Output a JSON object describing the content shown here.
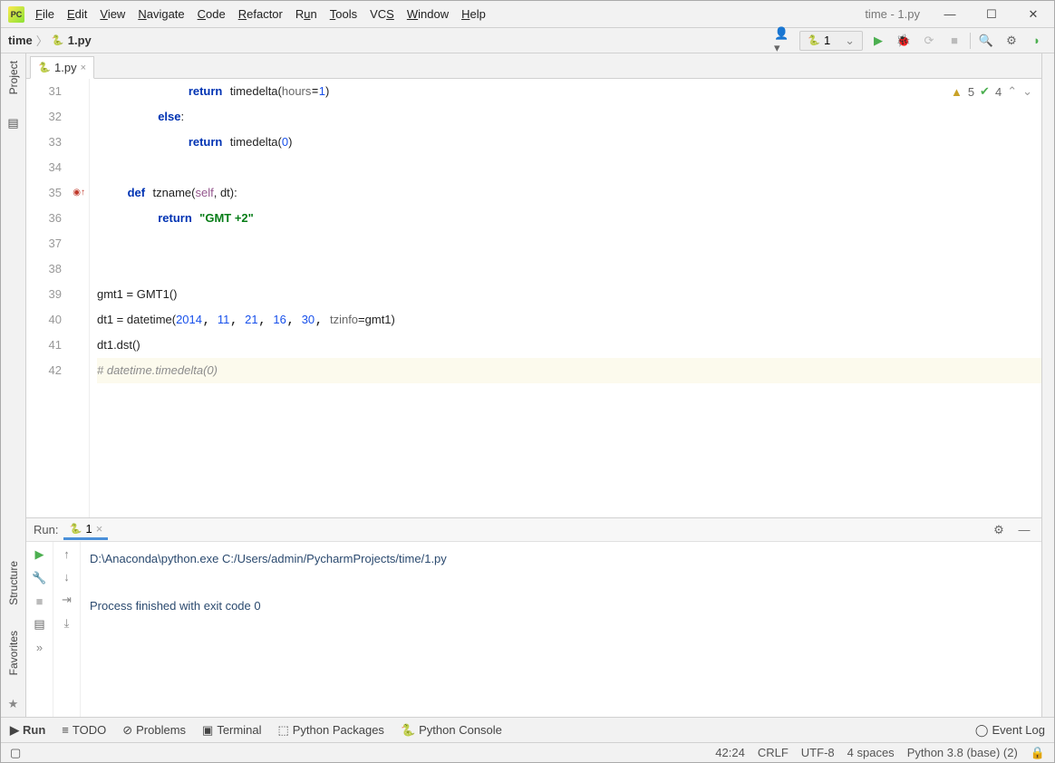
{
  "window": {
    "title": "time - 1.py"
  },
  "menu": {
    "file": "File",
    "edit": "Edit",
    "view": "View",
    "navigate": "Navigate",
    "code": "Code",
    "refactor": "Refactor",
    "run": "Run",
    "tools": "Tools",
    "vcs": "VCS",
    "window": "Window",
    "help": "Help"
  },
  "breadcrumb": {
    "root": "time",
    "file": "1.py"
  },
  "run_config": {
    "name": "1"
  },
  "tabs": {
    "file": "1.py"
  },
  "side_tabs": {
    "project": "Project",
    "structure": "Structure",
    "favorites": "Favorites"
  },
  "inspector": {
    "warn": "5",
    "ok": "4"
  },
  "code": {
    "lines": [
      "31",
      "32",
      "33",
      "34",
      "35",
      "36",
      "37",
      "38",
      "39",
      "40",
      "41",
      "42"
    ],
    "l31_kw": "return",
    "l31_fn": "timedelta(",
    "l31_p": "hours",
    "l31_n": "1",
    "l31_end": ")",
    "l32_kw": "else",
    "l32_colon": ":",
    "l33_kw": "return",
    "l33_fn": "timedelta(",
    "l33_n": "0",
    "l33_end": ")",
    "l35_def": "def",
    "l35_name": "tzname(",
    "l35_self": "self",
    "l35_rest": ", dt):",
    "l36_kw": "return",
    "l36_str": "\"GMT +2\"",
    "l39": "gmt1 = GMT1()",
    "l40_a": "dt1 = datetime(",
    "l40_n1": "2014",
    "l40_n2": "11",
    "l40_n3": "21",
    "l40_n4": "16",
    "l40_n5": "30",
    "l40_p": "tzinfo",
    "l40_rest": "=gmt1)",
    "l41": "dt1.dst()",
    "l42": "# datetime.timedelta(0)"
  },
  "run_panel": {
    "label": "Run:",
    "tab": "1",
    "line1": "D:\\Anaconda\\python.exe C:/Users/admin/PycharmProjects/time/1.py",
    "line2": "Process finished with exit code 0"
  },
  "bottom": {
    "run": "Run",
    "todo": "TODO",
    "problems": "Problems",
    "terminal": "Terminal",
    "pkg": "Python Packages",
    "console": "Python Console",
    "eventlog": "Event Log"
  },
  "status": {
    "pos": "42:24",
    "eol": "CRLF",
    "enc": "UTF-8",
    "indent": "4 spaces",
    "interp": "Python 3.8 (base) (2)"
  }
}
